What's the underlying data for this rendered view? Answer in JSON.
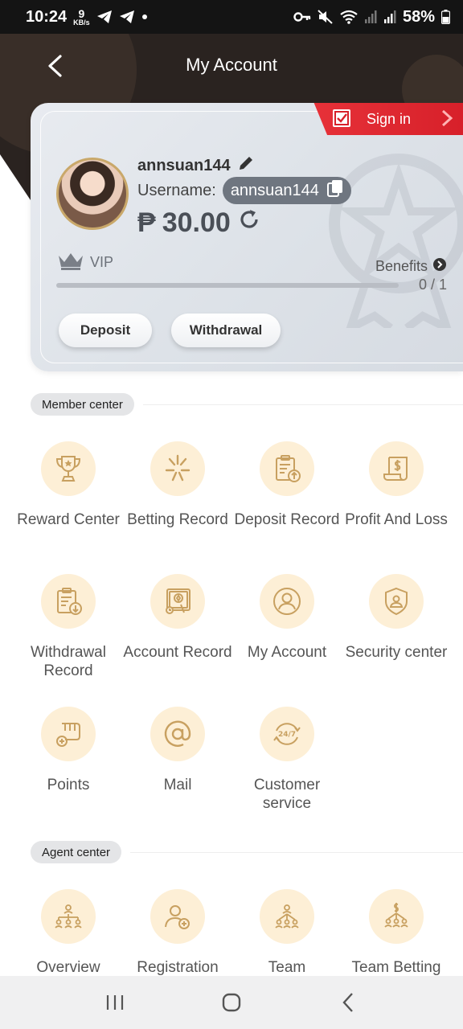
{
  "status_bar": {
    "time": "10:24",
    "net_speed": "9",
    "net_unit": "KB/s",
    "battery": "58%"
  },
  "header": {
    "title": "My Account"
  },
  "card": {
    "sign_in": "Sign in",
    "nickname": "annsuan144",
    "username_label": "Username:",
    "username": "annsuan144",
    "currency": "₱",
    "balance": "30.00",
    "vip_label": "VIP",
    "benefits_label": "Benefits",
    "progress_text": "0 / 1",
    "progress": 0,
    "deposit_btn": "Deposit",
    "withdrawal_btn": "Withdrawal"
  },
  "member_center": {
    "title": "Member center",
    "items": [
      {
        "label": "Reward Center",
        "icon": "trophy-icon"
      },
      {
        "label": "Betting Record",
        "icon": "betting-record-icon"
      },
      {
        "label": "Deposit Record",
        "icon": "deposit-record-icon"
      },
      {
        "label": "Profit And Loss",
        "icon": "profit-loss-icon"
      },
      {
        "label": "Withdrawal Record",
        "icon": "withdrawal-record-icon"
      },
      {
        "label": "Account Record",
        "icon": "account-record-icon"
      },
      {
        "label": "My Account",
        "icon": "user-icon"
      },
      {
        "label": "Security center",
        "icon": "shield-icon"
      },
      {
        "label": "Points",
        "icon": "points-icon"
      },
      {
        "label": "Mail",
        "icon": "mail-at-icon"
      },
      {
        "label": "Customer service",
        "icon": "support-24-7-icon"
      }
    ]
  },
  "agent_center": {
    "title": "Agent center",
    "items": [
      {
        "label": "Overview",
        "icon": "org-chart-icon"
      },
      {
        "label": "Registration",
        "icon": "add-user-icon"
      },
      {
        "label": "Team",
        "icon": "team-icon"
      },
      {
        "label": "Team Betting",
        "icon": "team-betting-icon"
      }
    ]
  },
  "colors": {
    "header_dark": "#2a2320",
    "accent_red": "#e8333a",
    "icon_gold": "#c8a060",
    "icon_bg": "#fdefd6"
  }
}
